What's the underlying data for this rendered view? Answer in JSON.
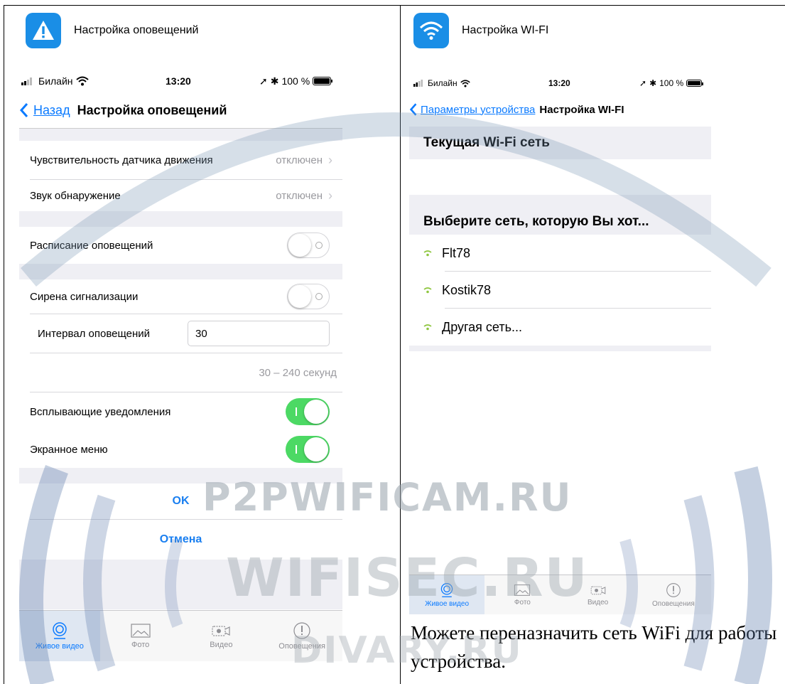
{
  "left": {
    "header_title": "Настройка оповещений",
    "status": {
      "carrier": "Билайн",
      "time": "13:20",
      "battery": "100 %"
    },
    "nav": {
      "back": "Назад",
      "title": "Настройка оповещений"
    },
    "rows": {
      "motion_label": "Чувствительность датчика движения",
      "motion_value": "отключен",
      "sound_label": "Звук обнаружение",
      "sound_value": "отключен",
      "schedule_label": "Расписание оповещений",
      "siren_label": "Сирена сигнализации",
      "interval_label": "Интервал оповещений",
      "interval_value": "30",
      "interval_hint": "30 – 240 секунд",
      "popup_label": "Всплывающие  уведомления",
      "osd_label": "Экранное меню"
    },
    "buttons": {
      "ok": "OK",
      "cancel": "Отмена"
    },
    "tabs": [
      "Живое видео",
      "Фото",
      "Видео",
      "Оповещения"
    ]
  },
  "right": {
    "header_title": "Настройка WI-FI",
    "status": {
      "carrier": "Билайн",
      "time": "13:20",
      "battery": "100 %"
    },
    "nav": {
      "back": "Параметры устройства",
      "title": "Настройка WI-FI"
    },
    "current_header": "Текущая Wi-Fi сеть",
    "choose_header": "Выберите сеть, которую Вы хот...",
    "networks": [
      "Flt78",
      "Kostik78",
      "Другая сеть..."
    ],
    "tabs": [
      "Живое видео",
      "Фото",
      "Видео",
      "Оповещения"
    ]
  },
  "caption": "Можете переназначить сеть WiFi для работы устройства.",
  "watermark": {
    "line1": "P2PWIFICAM.RU",
    "line2": "WIFISEC.RU",
    "line3": "DIVARY.RU"
  },
  "colors": {
    "ios_blue": "#0a7aff",
    "toggle_on": "#4cd964",
    "app_icon": "#1a8ee6",
    "wifi_dot": "#8ec63f"
  }
}
